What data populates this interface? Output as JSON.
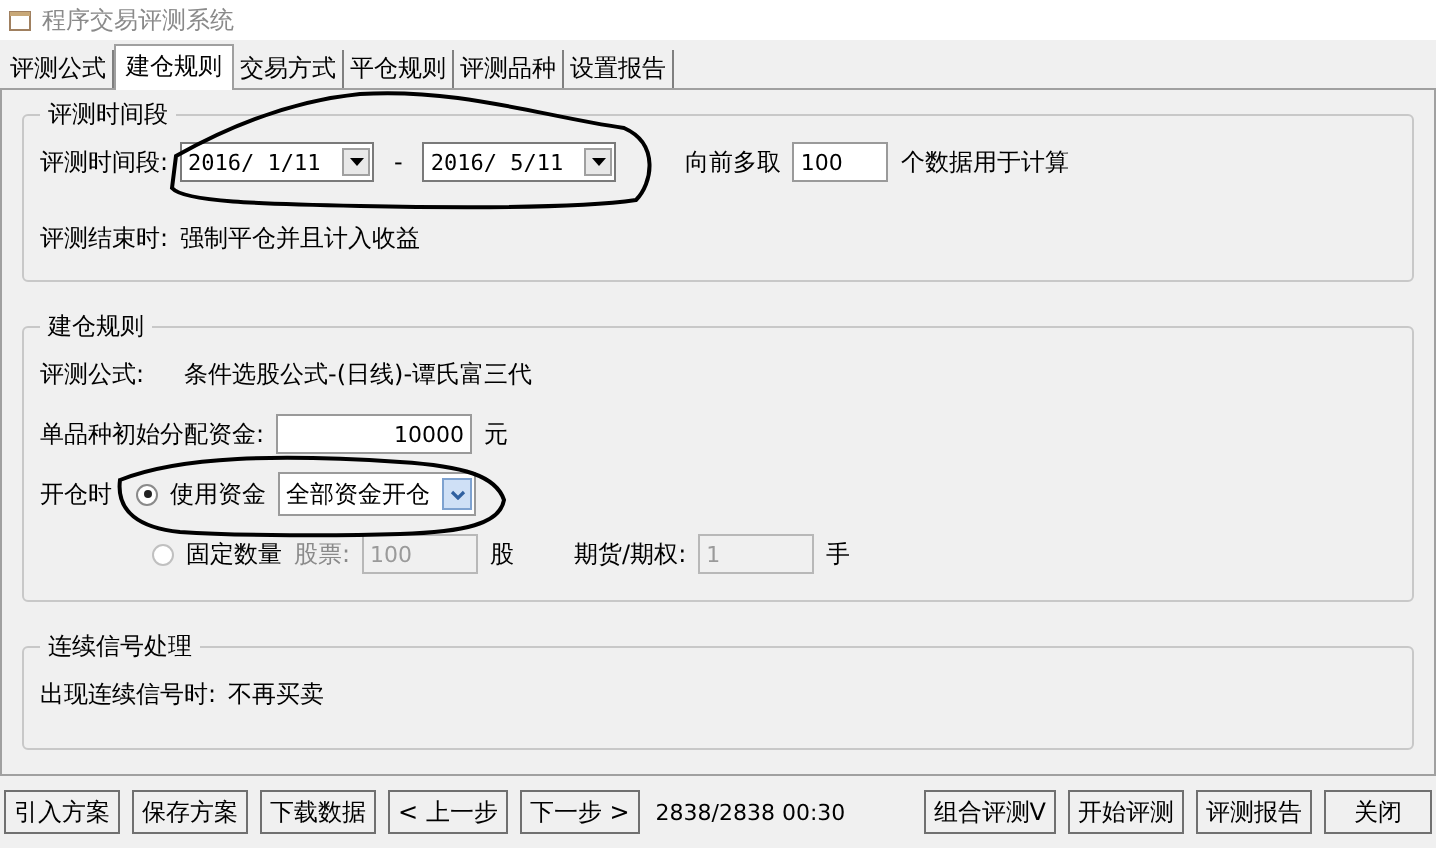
{
  "window": {
    "title": "程序交易评测系统"
  },
  "tabs": [
    {
      "label": "评测公式",
      "selected": false
    },
    {
      "label": "建仓规则",
      "selected": true
    },
    {
      "label": "交易方式",
      "selected": false
    },
    {
      "label": "平仓规则",
      "selected": false
    },
    {
      "label": "评测品种",
      "selected": false
    },
    {
      "label": "设置报告",
      "selected": false
    }
  ],
  "period_group": {
    "title": "评测时间段",
    "label": "评测时间段:",
    "start": "2016/ 1/11",
    "separator": "-",
    "end": "2016/ 5/11",
    "lookback_label": "向前多取",
    "lookback_value": "100",
    "lookback_suffix": "个数据用于计算",
    "end_rule_label": "评测结束时:",
    "end_rule_value": "强制平仓并且计入收益"
  },
  "open_group": {
    "title": "建仓规则",
    "formula_label": "评测公式:",
    "formula_value": "条件选股公式-(日线)-谭氏富三代",
    "capital_label": "单品种初始分配资金:",
    "capital_value": "10000",
    "capital_unit": "元",
    "open_label": "开仓时",
    "options": [
      {
        "kind": "capital",
        "label": "使用资金",
        "selected": true,
        "disabled": false,
        "choice": "全部资金开仓"
      },
      {
        "kind": "quantity",
        "label": "固定数量",
        "selected": false,
        "disabled": true,
        "stock_label": "股票:",
        "stock_value": "100",
        "stock_unit": "股",
        "futures_label": "期货/期权:",
        "futures_value": "1",
        "futures_unit": "手"
      }
    ]
  },
  "signal_group": {
    "title": "连续信号处理",
    "label": "出现连续信号时:",
    "value": "不再买卖"
  },
  "left_buttons": [
    "引入方案",
    "保存方案",
    "下载数据",
    "< 上一步",
    "下一步 >"
  ],
  "status": "2838/2838 00:30",
  "right_buttons": [
    "组合评测V",
    "开始评测",
    "评测报告",
    "关闭"
  ]
}
